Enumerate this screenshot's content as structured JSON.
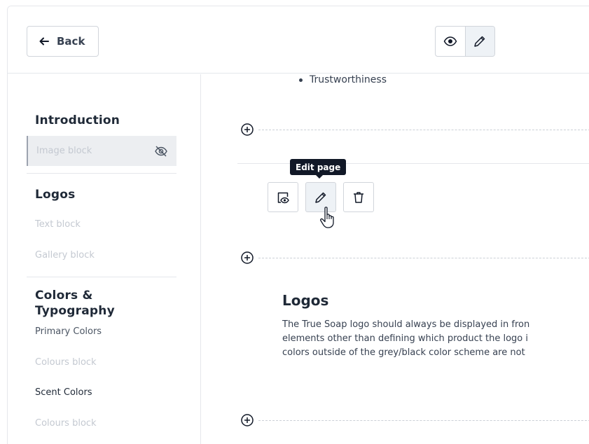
{
  "header": {
    "back_label": "Back",
    "back_icon": "arrow-left-icon",
    "view_icons": [
      "eye-icon",
      "pencil-icon"
    ],
    "active_view": "edit"
  },
  "sidebar": {
    "sections": [
      {
        "title": "Introduction",
        "items": [
          {
            "label": "Image block",
            "selected": true,
            "icon": "eye-off-icon"
          }
        ]
      },
      {
        "title": "Logos",
        "items": [
          {
            "label": "Text block"
          },
          {
            "label": "Gallery block"
          }
        ]
      },
      {
        "title_line1": "Colors &",
        "title_line2": "Typography",
        "items": [
          {
            "label": "Primary Colors"
          },
          {
            "label": "Colours block"
          },
          {
            "label": "Scent Colors"
          },
          {
            "label": "Colours block"
          }
        ]
      }
    ]
  },
  "content": {
    "bullet_text": "Trustworthiness",
    "tooltip": "Edit page",
    "block_tools": [
      "preview-icon",
      "pencil-icon",
      "trash-icon"
    ],
    "heading": "Logos",
    "paragraph_lines": [
      "The True Soap logo should always be displayed in fron",
      "elements other than defining which product the logo i",
      "colors outside of the grey/black color scheme are not"
    ]
  },
  "colors": {
    "divider": "#e5e7eb",
    "muted_text": "#c4c9d1",
    "tooltip_bg": "#111827",
    "active_bg": "#eef2f6"
  }
}
